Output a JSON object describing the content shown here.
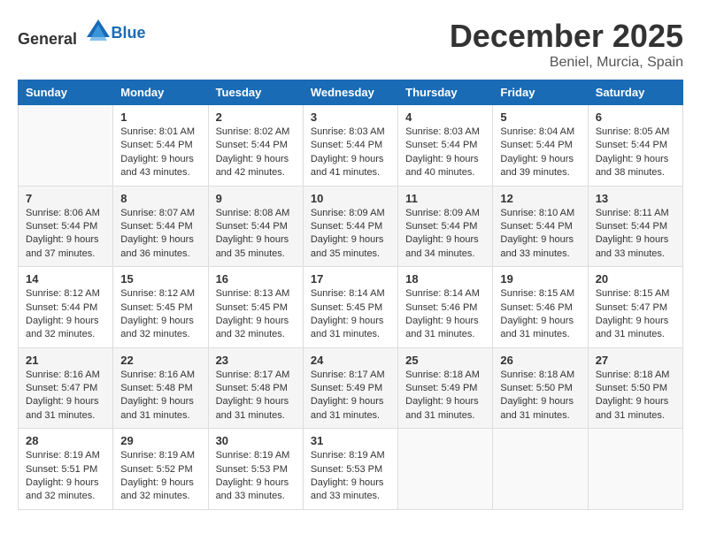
{
  "header": {
    "logo_general": "General",
    "logo_blue": "Blue",
    "month_title": "December 2025",
    "location": "Beniel, Murcia, Spain"
  },
  "days_of_week": [
    "Sunday",
    "Monday",
    "Tuesday",
    "Wednesday",
    "Thursday",
    "Friday",
    "Saturday"
  ],
  "weeks": [
    [
      {
        "day": "",
        "sunrise": "",
        "sunset": "",
        "daylight": ""
      },
      {
        "day": "1",
        "sunrise": "Sunrise: 8:01 AM",
        "sunset": "Sunset: 5:44 PM",
        "daylight": "Daylight: 9 hours and 43 minutes."
      },
      {
        "day": "2",
        "sunrise": "Sunrise: 8:02 AM",
        "sunset": "Sunset: 5:44 PM",
        "daylight": "Daylight: 9 hours and 42 minutes."
      },
      {
        "day": "3",
        "sunrise": "Sunrise: 8:03 AM",
        "sunset": "Sunset: 5:44 PM",
        "daylight": "Daylight: 9 hours and 41 minutes."
      },
      {
        "day": "4",
        "sunrise": "Sunrise: 8:03 AM",
        "sunset": "Sunset: 5:44 PM",
        "daylight": "Daylight: 9 hours and 40 minutes."
      },
      {
        "day": "5",
        "sunrise": "Sunrise: 8:04 AM",
        "sunset": "Sunset: 5:44 PM",
        "daylight": "Daylight: 9 hours and 39 minutes."
      },
      {
        "day": "6",
        "sunrise": "Sunrise: 8:05 AM",
        "sunset": "Sunset: 5:44 PM",
        "daylight": "Daylight: 9 hours and 38 minutes."
      }
    ],
    [
      {
        "day": "7",
        "sunrise": "Sunrise: 8:06 AM",
        "sunset": "Sunset: 5:44 PM",
        "daylight": "Daylight: 9 hours and 37 minutes."
      },
      {
        "day": "8",
        "sunrise": "Sunrise: 8:07 AM",
        "sunset": "Sunset: 5:44 PM",
        "daylight": "Daylight: 9 hours and 36 minutes."
      },
      {
        "day": "9",
        "sunrise": "Sunrise: 8:08 AM",
        "sunset": "Sunset: 5:44 PM",
        "daylight": "Daylight: 9 hours and 35 minutes."
      },
      {
        "day": "10",
        "sunrise": "Sunrise: 8:09 AM",
        "sunset": "Sunset: 5:44 PM",
        "daylight": "Daylight: 9 hours and 35 minutes."
      },
      {
        "day": "11",
        "sunrise": "Sunrise: 8:09 AM",
        "sunset": "Sunset: 5:44 PM",
        "daylight": "Daylight: 9 hours and 34 minutes."
      },
      {
        "day": "12",
        "sunrise": "Sunrise: 8:10 AM",
        "sunset": "Sunset: 5:44 PM",
        "daylight": "Daylight: 9 hours and 33 minutes."
      },
      {
        "day": "13",
        "sunrise": "Sunrise: 8:11 AM",
        "sunset": "Sunset: 5:44 PM",
        "daylight": "Daylight: 9 hours and 33 minutes."
      }
    ],
    [
      {
        "day": "14",
        "sunrise": "Sunrise: 8:12 AM",
        "sunset": "Sunset: 5:44 PM",
        "daylight": "Daylight: 9 hours and 32 minutes."
      },
      {
        "day": "15",
        "sunrise": "Sunrise: 8:12 AM",
        "sunset": "Sunset: 5:45 PM",
        "daylight": "Daylight: 9 hours and 32 minutes."
      },
      {
        "day": "16",
        "sunrise": "Sunrise: 8:13 AM",
        "sunset": "Sunset: 5:45 PM",
        "daylight": "Daylight: 9 hours and 32 minutes."
      },
      {
        "day": "17",
        "sunrise": "Sunrise: 8:14 AM",
        "sunset": "Sunset: 5:45 PM",
        "daylight": "Daylight: 9 hours and 31 minutes."
      },
      {
        "day": "18",
        "sunrise": "Sunrise: 8:14 AM",
        "sunset": "Sunset: 5:46 PM",
        "daylight": "Daylight: 9 hours and 31 minutes."
      },
      {
        "day": "19",
        "sunrise": "Sunrise: 8:15 AM",
        "sunset": "Sunset: 5:46 PM",
        "daylight": "Daylight: 9 hours and 31 minutes."
      },
      {
        "day": "20",
        "sunrise": "Sunrise: 8:15 AM",
        "sunset": "Sunset: 5:47 PM",
        "daylight": "Daylight: 9 hours and 31 minutes."
      }
    ],
    [
      {
        "day": "21",
        "sunrise": "Sunrise: 8:16 AM",
        "sunset": "Sunset: 5:47 PM",
        "daylight": "Daylight: 9 hours and 31 minutes."
      },
      {
        "day": "22",
        "sunrise": "Sunrise: 8:16 AM",
        "sunset": "Sunset: 5:48 PM",
        "daylight": "Daylight: 9 hours and 31 minutes."
      },
      {
        "day": "23",
        "sunrise": "Sunrise: 8:17 AM",
        "sunset": "Sunset: 5:48 PM",
        "daylight": "Daylight: 9 hours and 31 minutes."
      },
      {
        "day": "24",
        "sunrise": "Sunrise: 8:17 AM",
        "sunset": "Sunset: 5:49 PM",
        "daylight": "Daylight: 9 hours and 31 minutes."
      },
      {
        "day": "25",
        "sunrise": "Sunrise: 8:18 AM",
        "sunset": "Sunset: 5:49 PM",
        "daylight": "Daylight: 9 hours and 31 minutes."
      },
      {
        "day": "26",
        "sunrise": "Sunrise: 8:18 AM",
        "sunset": "Sunset: 5:50 PM",
        "daylight": "Daylight: 9 hours and 31 minutes."
      },
      {
        "day": "27",
        "sunrise": "Sunrise: 8:18 AM",
        "sunset": "Sunset: 5:50 PM",
        "daylight": "Daylight: 9 hours and 31 minutes."
      }
    ],
    [
      {
        "day": "28",
        "sunrise": "Sunrise: 8:19 AM",
        "sunset": "Sunset: 5:51 PM",
        "daylight": "Daylight: 9 hours and 32 minutes."
      },
      {
        "day": "29",
        "sunrise": "Sunrise: 8:19 AM",
        "sunset": "Sunset: 5:52 PM",
        "daylight": "Daylight: 9 hours and 32 minutes."
      },
      {
        "day": "30",
        "sunrise": "Sunrise: 8:19 AM",
        "sunset": "Sunset: 5:53 PM",
        "daylight": "Daylight: 9 hours and 33 minutes."
      },
      {
        "day": "31",
        "sunrise": "Sunrise: 8:19 AM",
        "sunset": "Sunset: 5:53 PM",
        "daylight": "Daylight: 9 hours and 33 minutes."
      },
      {
        "day": "",
        "sunrise": "",
        "sunset": "",
        "daylight": ""
      },
      {
        "day": "",
        "sunrise": "",
        "sunset": "",
        "daylight": ""
      },
      {
        "day": "",
        "sunrise": "",
        "sunset": "",
        "daylight": ""
      }
    ]
  ]
}
